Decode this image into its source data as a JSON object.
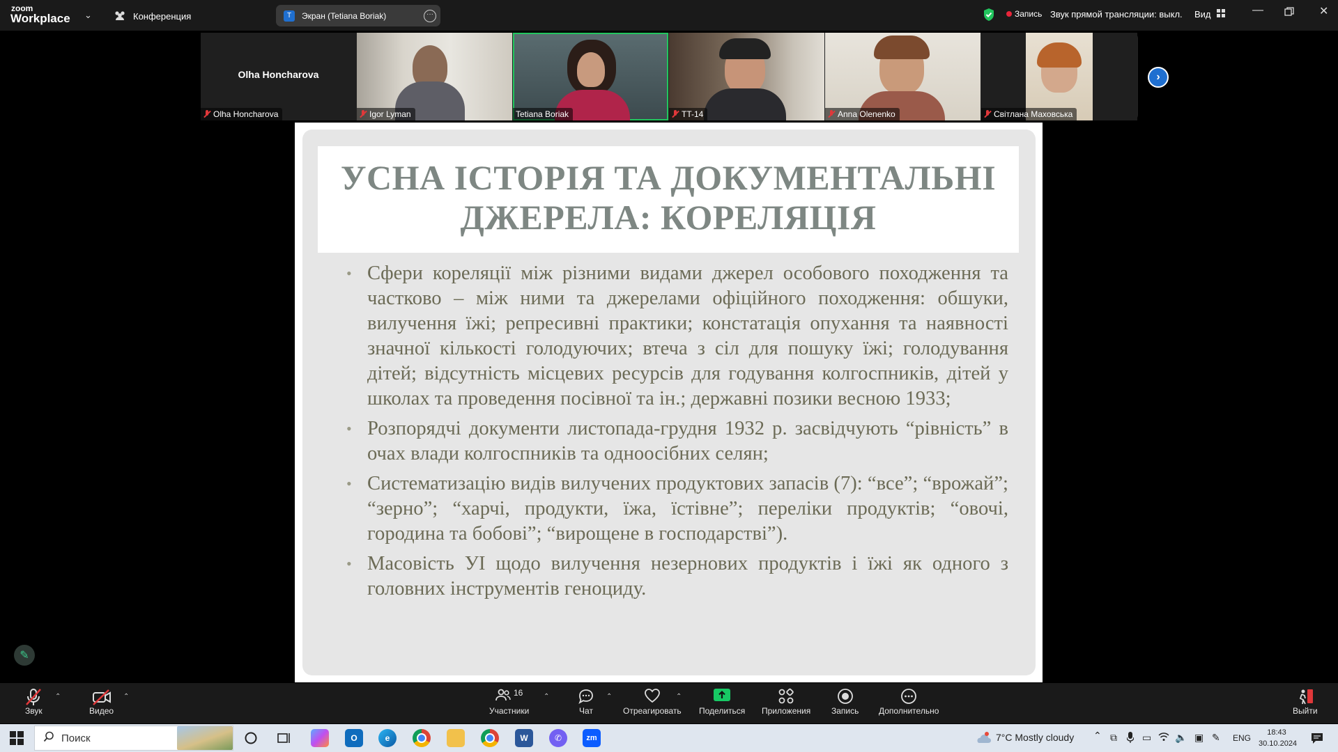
{
  "app": {
    "logo_small": "zoom",
    "logo_big": "Workplace"
  },
  "meeting": {
    "label": "Конференция"
  },
  "share_pill": {
    "avatar_letter": "T",
    "label": "Экран (Tetiana Boriak)"
  },
  "status": {
    "record": "Запись",
    "livestream": "Звук прямой трансляции: выкл.",
    "view": "Вид"
  },
  "participants": [
    {
      "name": "Olha Honcharova",
      "display": "Olha Honcharova"
    },
    {
      "name": "Igor Lyman"
    },
    {
      "name": "Tetiana Boriak"
    },
    {
      "name": "TT-14"
    },
    {
      "name": "Anna Olenenko"
    },
    {
      "name": "Світлана Маховська"
    }
  ],
  "slide": {
    "title_line1": "УСНА ІСТОРІЯ ТА ДОКУМЕНТАЛЬНІ",
    "title_line2": "ДЖЕРЕЛА: КОРЕЛЯЦІЯ",
    "bullets": [
      "Сфери кореляції між різними видами джерел особового походження та частково – між ними та джерелами офіційного походження: обшуки, вилучення їжі; репресивні практики; констатація опухання та наявності значної кількості голодуючих; втеча з сіл для пошуку їжі; голодування дітей; відсутність місцевих ресурсів для годування колгоспників, дітей у школах та проведення посівної та ін.; державні позики весною 1933;",
      "Розпорядчі документи листопада-грудня 1932 р. засвідчують “рівність” в очах влади колгоспників та одноосібних селян;",
      "Систематизацію видів вилучених продуктових запасів (7): “все”; “врожай”; “зерно”; “харчі, продукти, їжа, їстівне”; переліки продуктів; “овочі, городина та бобові”; “вирощене в господарстві”).",
      "Масовість УІ щодо вилучення незернових продуктів і їжі як одного з головних інструментів геноциду."
    ]
  },
  "toolbar": {
    "audio": "Звук",
    "video": "Видео",
    "participants": "Участники",
    "participants_count": "16",
    "chat": "Чат",
    "react": "Отреагировать",
    "share": "Поделиться",
    "apps": "Приложения",
    "record": "Запись",
    "more": "Дополнительно",
    "leave": "Выйти"
  },
  "taskbar": {
    "search_placeholder": "Поиск",
    "weather": "7°C  Mostly cloudy",
    "lang": "ENG",
    "time": "18:43",
    "date": "30.10.2024"
  },
  "colors": {
    "accent": "#1f6fd0",
    "active_speaker": "#22c55e",
    "record_red": "#e8253a",
    "share_green": "#17c964"
  }
}
